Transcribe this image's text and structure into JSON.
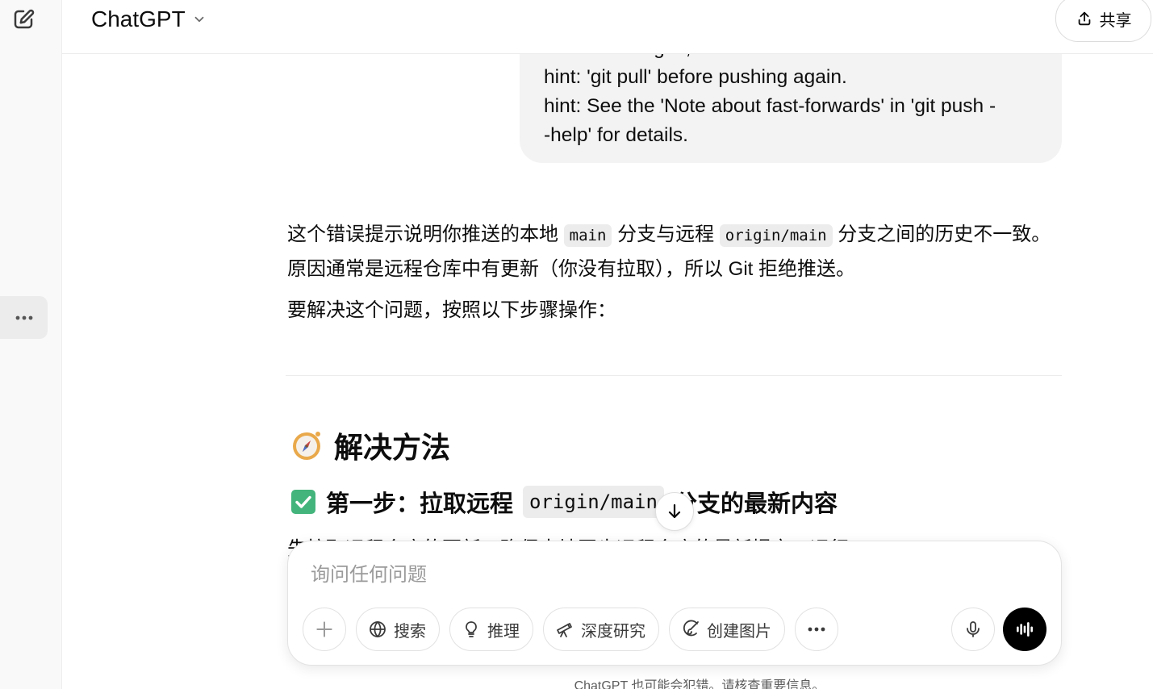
{
  "header": {
    "model_name": "ChatGPT",
    "share_label": "共享"
  },
  "user_message": {
    "lines": [
      "remote changes, use",
      "hint: 'git pull' before pushing again.",
      "hint: See the 'Note about fast-forwards' in 'git push -",
      "-help' for details."
    ]
  },
  "answer": {
    "p1_a": "这个错误提示说明你推送的本地",
    "p1_code1": "main",
    "p1_b": "分支与远程",
    "p1_code2": "origin/main",
    "p1_c": "分支之间的历史不一致。原因通常是远程仓库中有更新（你没有拉取），所以 Git 拒绝推送。",
    "p2": "要解决这个问题，按照以下步骤操作：",
    "heading": "解决方法",
    "step_a": "第一步：拉取远程",
    "step_code": "origin/main",
    "step_b": "分支的最新内容",
    "cut_line": "先拉取远程仓库的更新，确保本地同步远程仓库的最新提交，运行："
  },
  "composer": {
    "placeholder": "询问任何问题",
    "tools": {
      "search": "搜索",
      "reason": "推理",
      "deep_research": "深度研究",
      "create_image": "创建图片"
    }
  },
  "disclaimer": "ChatGPT 也可能会犯错。请核查重要信息。",
  "icons": {
    "new_chat": "new-chat-icon",
    "more": "more-icon",
    "share": "share-icon",
    "chevron": "chevron-down-icon",
    "plus": "plus-icon",
    "globe": "globe-icon",
    "bulb": "lightbulb-icon",
    "telescope": "telescope-icon",
    "paint": "image-brush-icon",
    "mic": "mic-icon",
    "voice": "voice-mode-icon",
    "arrow_down": "arrow-down-icon",
    "compass": "compass-emoji",
    "check": "check-mark-emoji"
  },
  "colors": {
    "accent_black": "#000000",
    "bubble_bg": "#f3f3f3",
    "check_green": "#43b47c"
  }
}
